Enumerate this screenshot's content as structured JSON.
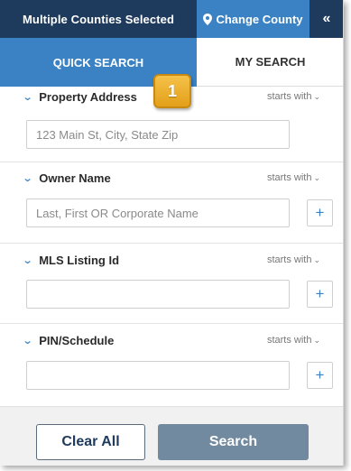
{
  "topbar": {
    "counties_label": "Multiple Counties Selected",
    "change_county_label": "Change County",
    "collapse_glyph": "«"
  },
  "tabs": [
    {
      "label": "QUICK SEARCH",
      "active": true
    },
    {
      "label": "MY SEARCH",
      "active": false
    }
  ],
  "callout_badge": "1",
  "fields": {
    "property_address": {
      "label": "Property Address",
      "match": "starts with",
      "placeholder": "123 Main St, City, State Zip",
      "value": ""
    },
    "owner_name": {
      "label": "Owner Name",
      "match": "starts with",
      "placeholder": "Last, First OR Corporate Name",
      "value": ""
    },
    "mls_listing_id": {
      "label": "MLS Listing Id",
      "match": "starts with",
      "placeholder": "",
      "value": ""
    },
    "pin_schedule": {
      "label": "PIN/Schedule",
      "match": "starts with",
      "placeholder": "",
      "value": ""
    }
  },
  "footer": {
    "clear_label": "Clear All",
    "search_label": "Search"
  },
  "colors": {
    "navy": "#1e3a5c",
    "accent_blue": "#3b82c4",
    "search_button": "#728aa0",
    "badge_gold": "#e3a019"
  }
}
